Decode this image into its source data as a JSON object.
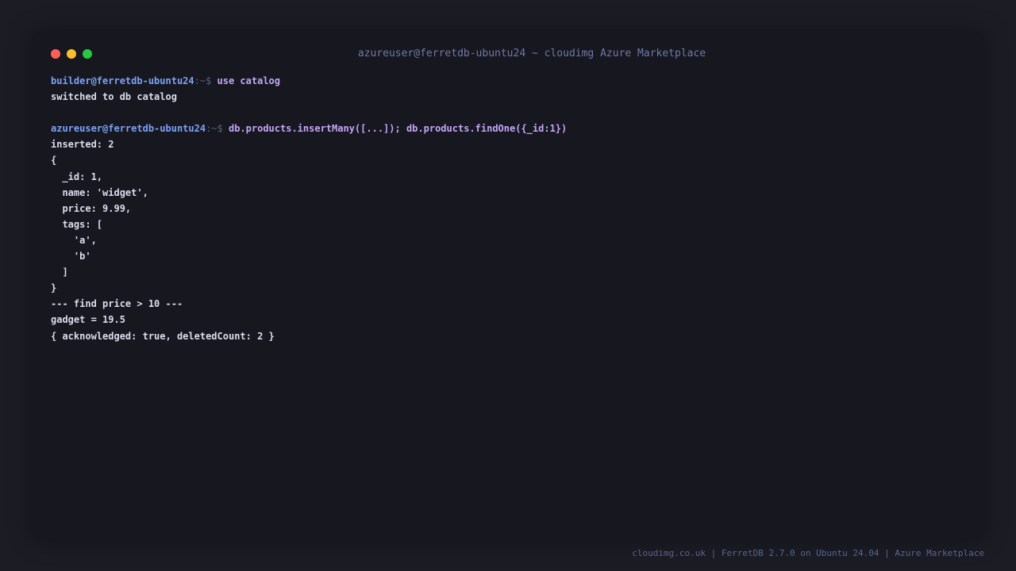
{
  "window": {
    "title": "azureuser@ferretdb-ubuntu24 ~ cloudimg Azure Marketplace",
    "controls": [
      "close",
      "minimize",
      "maximize"
    ]
  },
  "colors": {
    "background": "#1c1c25",
    "window": "#171720",
    "prompt": "#7aa2f7",
    "command": "#c3a6f7",
    "output": "#dcdcec",
    "close": "#ff5f57",
    "minimize": "#febc2e",
    "maximize": "#28c840"
  },
  "terminal": {
    "lines": [
      {
        "type": "prompt",
        "user_host": "builder@ferretdb-ubuntu24",
        "sep": ":~$ ",
        "command": "use catalog"
      },
      {
        "type": "output",
        "text": "switched to db catalog"
      },
      {
        "type": "blank",
        "text": ""
      },
      {
        "type": "prompt",
        "user_host": "azureuser@ferretdb-ubuntu24",
        "sep": ":~$ ",
        "command": "db.products.insertMany([...]); db.products.findOne({_id:1})"
      },
      {
        "type": "output",
        "text": "inserted: 2"
      },
      {
        "type": "output",
        "text": "{"
      },
      {
        "type": "output",
        "text": "  _id: 1,"
      },
      {
        "type": "output",
        "text": "  name: 'widget',"
      },
      {
        "type": "output",
        "text": "  price: 9.99,"
      },
      {
        "type": "output",
        "text": "  tags: ["
      },
      {
        "type": "output",
        "text": "    'a',"
      },
      {
        "type": "output",
        "text": "    'b'"
      },
      {
        "type": "output",
        "text": "  ]"
      },
      {
        "type": "output",
        "text": "}"
      },
      {
        "type": "output",
        "text": "--- find price > 10 ---"
      },
      {
        "type": "output",
        "text": "gadget = 19.5"
      },
      {
        "type": "output",
        "text": "{ acknowledged: true, deletedCount: 2 }"
      }
    ]
  },
  "footer": {
    "text": "cloudimg.co.uk | FerretDB 2.7.0 on Ubuntu 24.04 | Azure Marketplace"
  }
}
